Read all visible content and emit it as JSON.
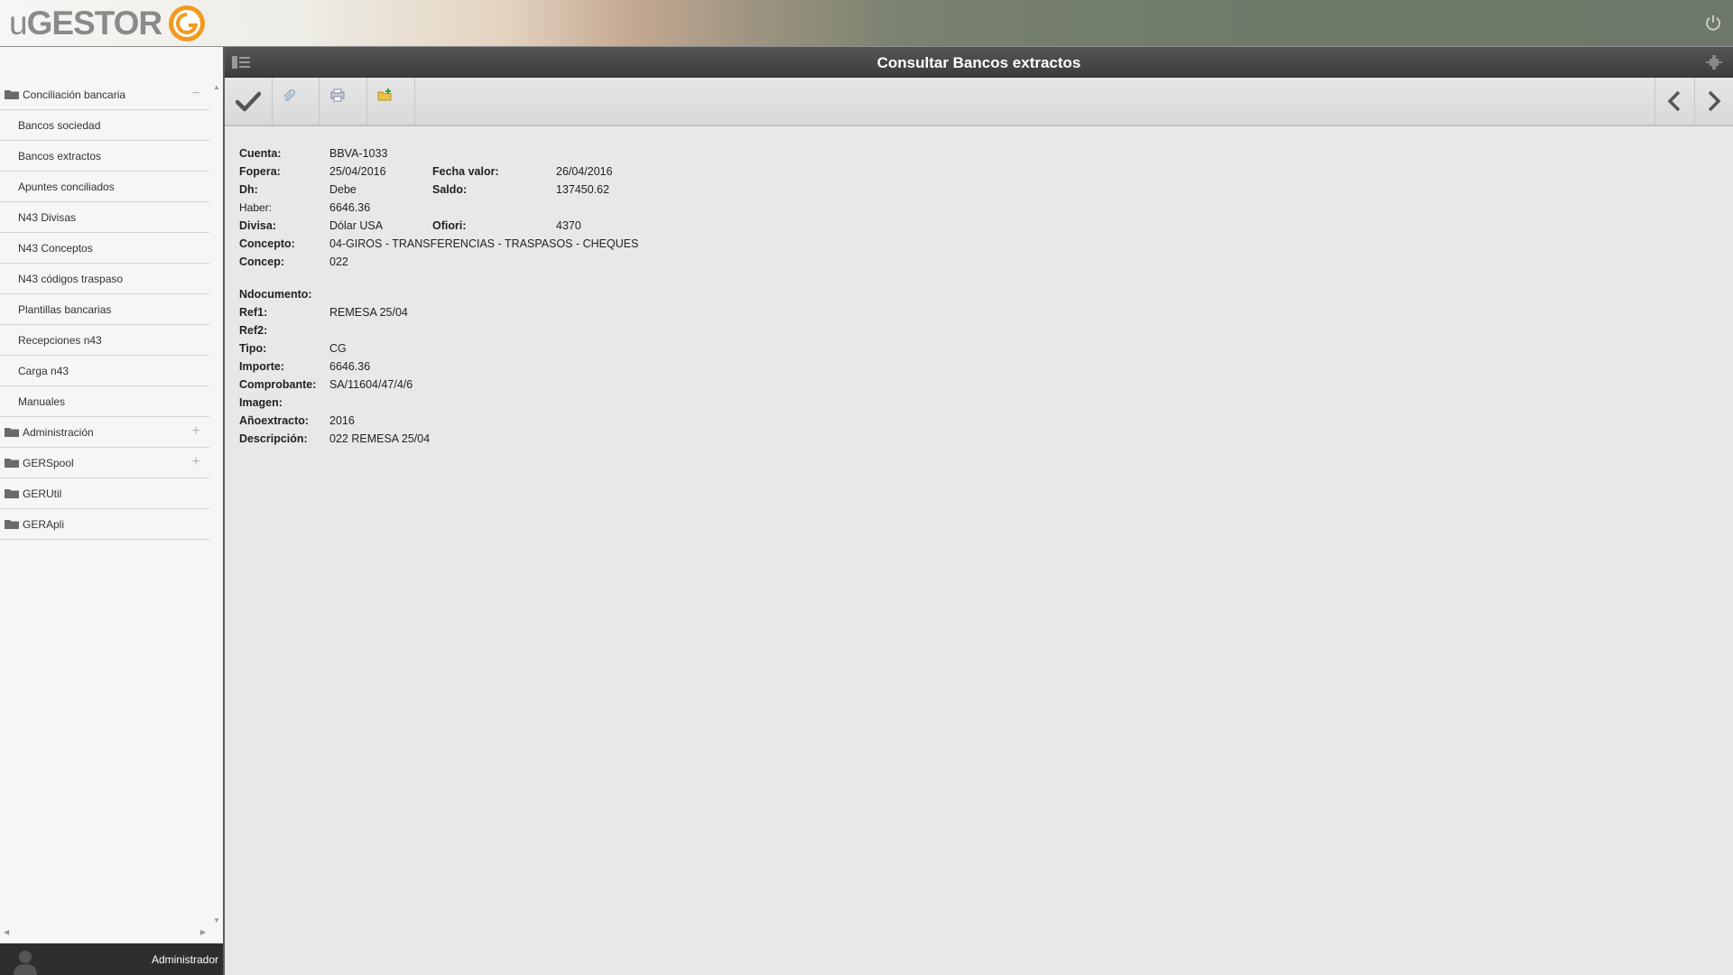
{
  "app": {
    "logo_prefix": "u",
    "logo_main": "GESTOR",
    "user_name": "Administrador"
  },
  "sidebar": {
    "sections": [
      {
        "label": "Conciliación bancaria",
        "toggle": "−",
        "expanded": true,
        "items": [
          "Bancos sociedad",
          "Bancos extractos",
          "Apuntes conciliados",
          "N43 Divisas",
          "N43 Conceptos",
          "N43 códigos traspaso",
          "Plantillas bancarias",
          "Recepciones n43",
          "Carga n43",
          "Manuales"
        ]
      },
      {
        "label": "Administración",
        "toggle": "+"
      },
      {
        "label": "GERSpool",
        "toggle": "+"
      },
      {
        "label": "GERUtil",
        "toggle": ""
      },
      {
        "label": "GERApli",
        "toggle": ""
      }
    ]
  },
  "header": {
    "title": "Consultar Bancos extractos"
  },
  "form": {
    "cuenta": {
      "label": "Cuenta:",
      "value": "BBVA-1033"
    },
    "fopera": {
      "label": "Fopera:",
      "value": "25/04/2016"
    },
    "fecha_valor": {
      "label": "Fecha valor:",
      "value": "26/04/2016"
    },
    "dh": {
      "label": "Dh:",
      "value": "Debe"
    },
    "saldo": {
      "label": "Saldo:",
      "value": "137450.62"
    },
    "haber": {
      "label": "Haber:",
      "value": "6646.36"
    },
    "divisa": {
      "label": "Divisa:",
      "value": "Dólar USA"
    },
    "ofiori": {
      "label": "Ofiori:",
      "value": "4370"
    },
    "concepto": {
      "label": "Concepto:",
      "value": "04-GIROS - TRANSFERENCIAS - TRASPASOS - CHEQUES"
    },
    "concep": {
      "label": "Concep:",
      "value": "022"
    },
    "ndocumento": {
      "label": "Ndocumento:",
      "value": ""
    },
    "ref1": {
      "label": "Ref1:",
      "value": "REMESA 25/04"
    },
    "ref2": {
      "label": "Ref2:",
      "value": ""
    },
    "tipo": {
      "label": "Tipo:",
      "value": "CG"
    },
    "importe": {
      "label": "Importe:",
      "value": "6646.36"
    },
    "comprobante": {
      "label": "Comprobante:",
      "value": "SA/11604/47/4/6"
    },
    "imagen": {
      "label": "Imagen:",
      "value": ""
    },
    "anoextracto": {
      "label": "Añoextracto:",
      "value": "2016"
    },
    "descripcion": {
      "label": "Descripción:",
      "value": "022 REMESA 25/04"
    }
  },
  "colors": {
    "logo_orange": "#f39a1e",
    "header_dark": "#444444",
    "sidebar_bg": "#f6f6f6",
    "content_bg": "#e8e8e8"
  },
  "icons": {
    "toolbar": [
      "check-icon",
      "attach-icon",
      "print-icon",
      "folder-add-icon"
    ],
    "nav": [
      "chevron-left-icon",
      "chevron-right-icon"
    ]
  }
}
